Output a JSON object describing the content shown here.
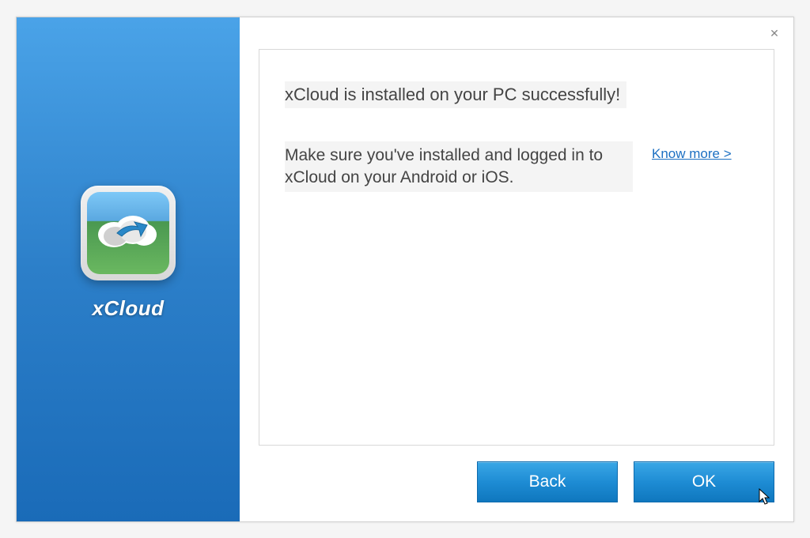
{
  "sidebar": {
    "app_name": "xCloud"
  },
  "content": {
    "success_message": "xCloud is installed on your PC successfully!",
    "instruction_message": "Make sure you've installed and logged in to xCloud on your Android or iOS.",
    "know_more_label": "Know more >"
  },
  "buttons": {
    "back_label": "Back",
    "ok_label": "OK"
  }
}
